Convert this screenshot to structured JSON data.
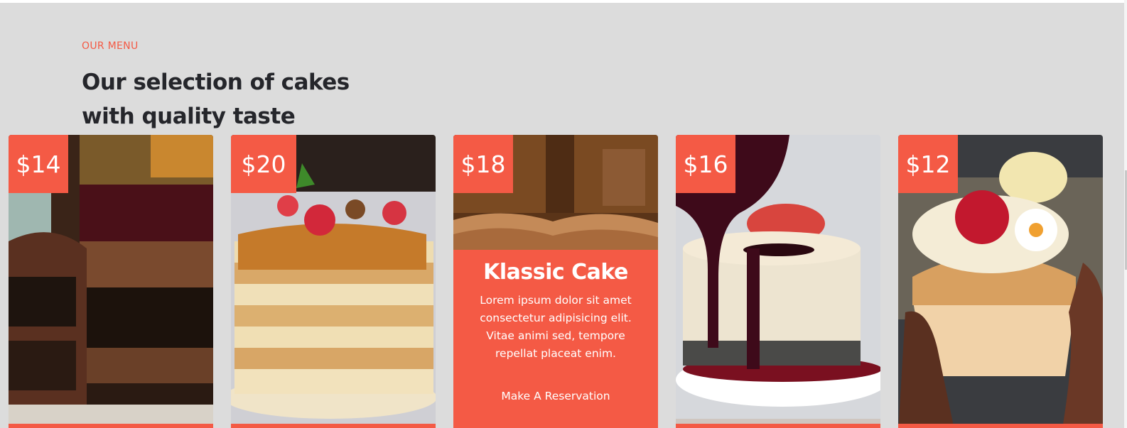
{
  "section": {
    "eyebrow": "OUR MENU",
    "heading_line1": "Our selection of cakes",
    "heading_line2": "with quality taste"
  },
  "cards": [
    {
      "price": "$14",
      "image": "chocolate-layer-cake"
    },
    {
      "price": "$20",
      "image": "caramel-pancake-stack"
    },
    {
      "price": "$18",
      "image": "pastry",
      "title": "Klassic Cake",
      "description": "Lorem ipsum dolor sit amet consectetur adipisicing elit. Vitae animi sed, tempore repellat placeat enim.",
      "cta": "Make A Reservation"
    },
    {
      "price": "$16",
      "image": "berry-cheesecake"
    },
    {
      "price": "$12",
      "image": "raspberry-cupcake"
    }
  ],
  "colors": {
    "accent": "#f45a45",
    "background": "#dcdcdc",
    "heading": "#25262b",
    "on_accent": "#ffffff"
  }
}
